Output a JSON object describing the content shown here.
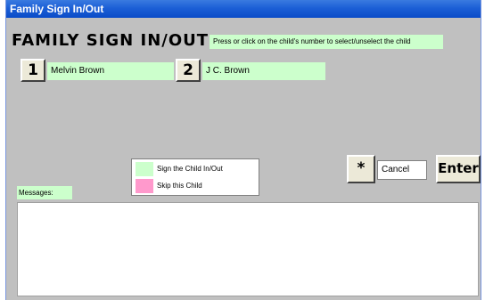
{
  "window": {
    "title": "Family Sign In/Out"
  },
  "header": {
    "title": "FAMILY SIGN IN/OUT",
    "instruction": "Press or click on the child's number to select/unselect the child"
  },
  "children": [
    {
      "number": "1",
      "name": "Melvin Brown"
    },
    {
      "number": "2",
      "name": "J C. Brown"
    }
  ],
  "legend": [
    {
      "label": "Sign the Child In/Out",
      "color": "#ccffcc"
    },
    {
      "label": "Skip this Child",
      "color": "#ff99cc"
    }
  ],
  "controls": {
    "star_label": "*",
    "cancel_label": "Cancel",
    "enter_label": "Enter"
  },
  "messages": {
    "label": "Messages:",
    "content": ""
  }
}
